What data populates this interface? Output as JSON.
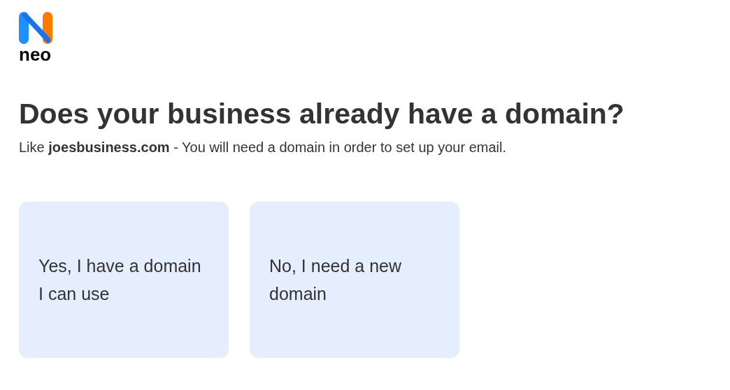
{
  "logo": {
    "text": "neo"
  },
  "heading": "Does your business already have a domain?",
  "subtitle": "Like **joesbusiness.com** - You will need a domain in order to set up your email.",
  "options": [
    {
      "label": "Yes, I have a domain I can use"
    },
    {
      "label": "No, I need a new domain"
    }
  ]
}
